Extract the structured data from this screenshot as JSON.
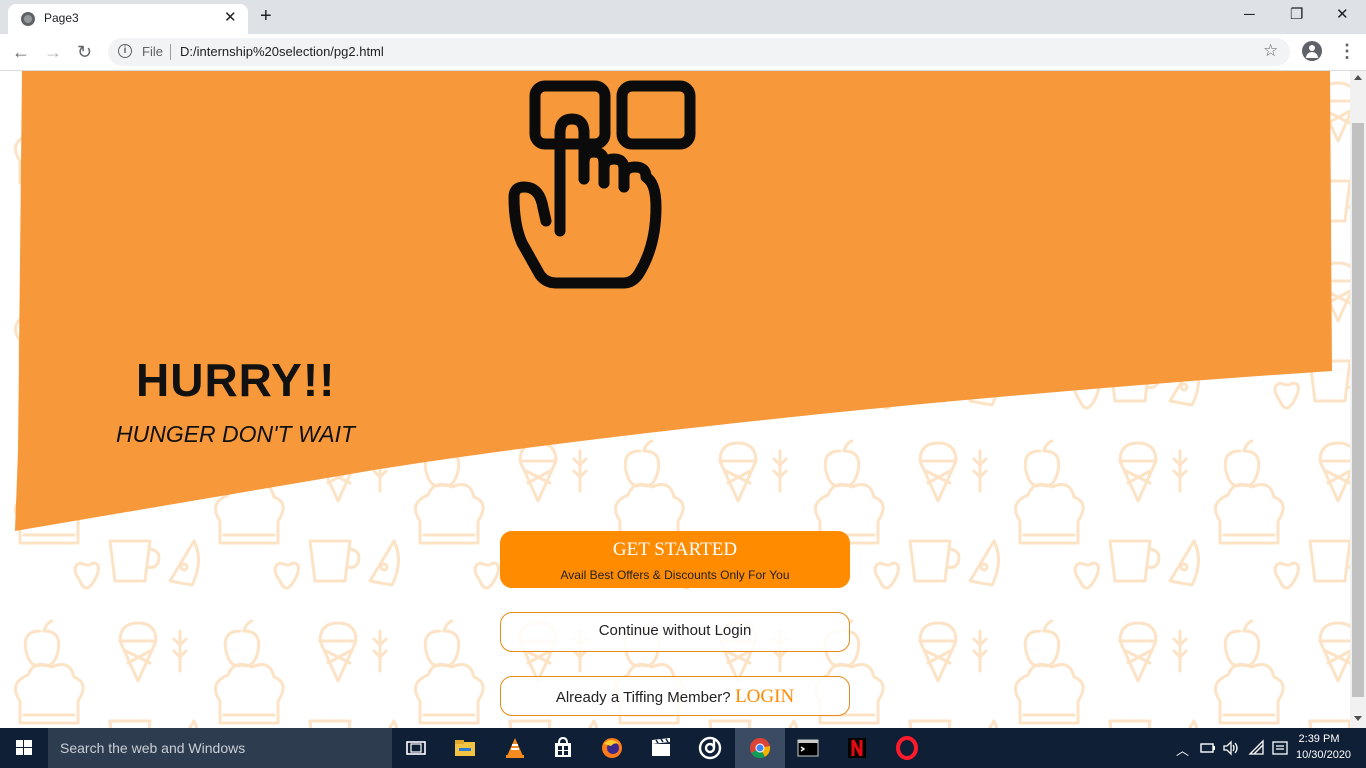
{
  "browser": {
    "tab_title": "Page3",
    "tab_close": "✕",
    "new_tab": "+",
    "window_controls": {
      "minimize": "─",
      "restore": "❐",
      "close": "✕"
    },
    "back": "←",
    "forward": "→",
    "reload": "↻",
    "security_label": "File",
    "url": "D:/internship%20selection/pg2.html",
    "star": "☆",
    "menu": "⋮"
  },
  "page": {
    "colors": {
      "accent": "#f7993a",
      "button": "#ff8b00",
      "pattern": "#fde8d0"
    },
    "hero_icon": "hand-pointer-icon",
    "headline": "HURRY!!",
    "tagline": "HUNGER DON'T WAIT",
    "get_started": {
      "title": "GET STARTED",
      "subtitle": "Avail Best Offers & Discounts Only For You"
    },
    "continue_label": "Continue without Login",
    "member": {
      "label": "Already a Tiffing Member?",
      "link": "LOGIN"
    }
  },
  "taskbar": {
    "search_placeholder": "Search the web and Windows",
    "apps": [
      "task-view-icon",
      "file-explorer-icon",
      "vlc-icon",
      "store-icon",
      "firefox-icon",
      "movies-icon",
      "groove-icon",
      "chrome-icon",
      "terminal-icon",
      "netflix-icon",
      "opera-icon"
    ],
    "time": "2:39 PM",
    "date": "10/30/2020"
  }
}
